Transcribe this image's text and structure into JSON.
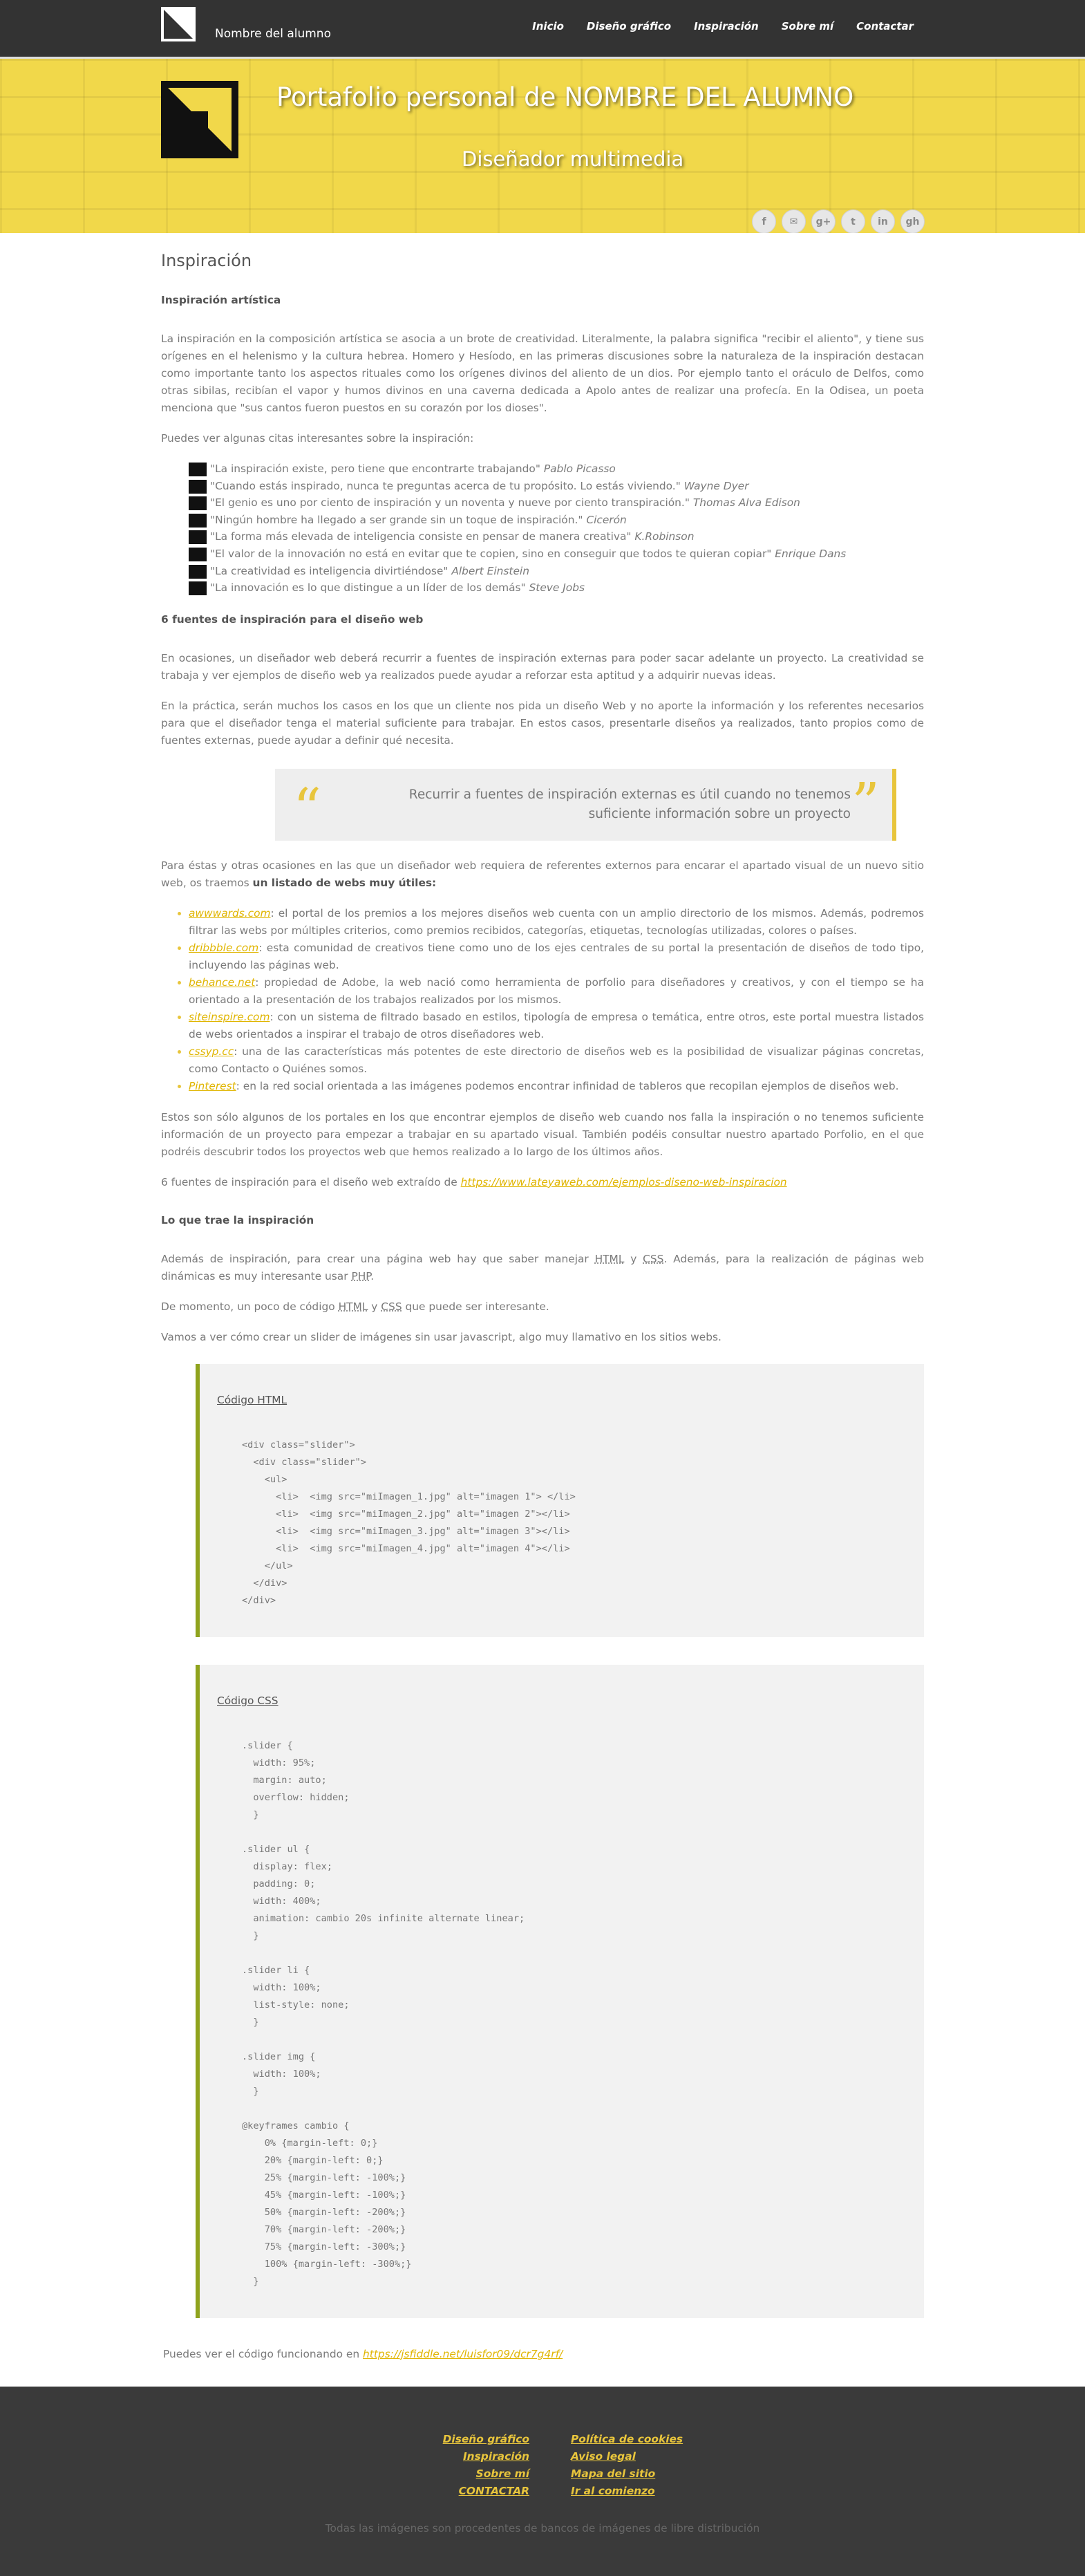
{
  "header": {
    "brand_name": "Nombre del alumno",
    "nav": [
      "Inicio",
      "Diseño gráfico",
      "Inspiración",
      "Sobre mí",
      "Contactar"
    ]
  },
  "hero": {
    "title": "Portafolio personal de NOMBRE DEL ALUMNO",
    "subtitle": "Diseñador multimedia",
    "social_icons": [
      "facebook-icon",
      "email-icon",
      "google-plus-icon",
      "twitter-icon",
      "linkedin-icon",
      "github-icon"
    ],
    "social_glyphs": [
      "f",
      "✉",
      "g+",
      "t",
      "in",
      "gh"
    ]
  },
  "main": {
    "title": "Inspiración",
    "section1_heading": "Inspiración artística",
    "p1": "La inspiración en la composición artística se asocia a un brote de creatividad. Literalmente, la palabra significa \"recibir el aliento\", y tiene sus orígenes en el helenismo y la cultura hebrea. Homero y Hesíodo, en las primeras discusiones sobre la naturaleza de la inspiración destacan como importante tanto los aspectos rituales como los orígenes divinos del aliento de un dios. Por ejemplo tanto el oráculo de Delfos, como otras sibilas, recibían el vapor y humos divinos en una caverna dedicada a Apolo antes de realizar una profecía. En la Odisea, un poeta menciona que \"sus cantos fueron puestos en su corazón por los dioses\".",
    "p2": "Puedes ver algunas citas interesantes sobre la inspiración:",
    "quotes": [
      {
        "text": "\"La inspiración existe, pero tiene que encontrarte trabajando\"",
        "author": "Pablo Picasso"
      },
      {
        "text": "\"Cuando estás inspirado, nunca te preguntas acerca de tu propósito. Lo estás viviendo.\"",
        "author": "Wayne Dyer"
      },
      {
        "text": "\"El genio es uno por ciento de inspiración y un noventa y nueve por ciento transpiración.\"",
        "author": "Thomas Alva Edison"
      },
      {
        "text": "\"Ningún hombre ha llegado a ser grande sin un toque de inspiración.\"",
        "author": "Cicerón"
      },
      {
        "text": "\"La forma más elevada de inteligencia consiste en pensar de manera creativa\"",
        "author": "K.Robinson"
      },
      {
        "text": "\"El valor de la innovación no está en evitar que te copien, sino en conseguir que todos te quieran copiar\"",
        "author": "Enrique Dans"
      },
      {
        "text": "\"La creatividad es inteligencia divirtiéndose\"",
        "author": "Albert Einstein"
      },
      {
        "text": "\"La innovación es lo que distingue a un líder de los demás\"",
        "author": "Steve Jobs"
      }
    ],
    "section2_heading": "6 fuentes de inspiración para el diseño web",
    "p3": "En ocasiones, un diseñador web deberá recurrir a fuentes de inspiración externas para poder sacar adelante un proyecto. La creatividad se trabaja y ver ejemplos de diseño web ya realizados puede ayudar a reforzar esta aptitud y a adquirir nuevas ideas.",
    "p4": "En la práctica, serán muchos los casos en los que un cliente nos pida un diseño Web y no aporte la información y los referentes necesarios para que el diseñador tenga el material suficiente para trabajar. En estos casos, presentarle diseños ya realizados, tanto propios como de fuentes externas, puede ayudar a definir qué necesita.",
    "blockquote": "Recurrir a fuentes de inspiración externas es útil cuando no tenemos suficiente información sobre un proyecto",
    "p5_pre": "Para éstas y otras ocasiones en las que un diseñador web requiera de referentes externos para encarar el apartado visual de un nuevo sitio web, os traemos ",
    "p5_bold": "un listado de webs muy útiles:",
    "links": [
      {
        "name": "awwwards.com",
        "desc": ": el portal de los premios a los mejores diseños web cuenta con un amplio directorio de los mismos. Además, podremos filtrar las webs por múltiples criterios, como premios recibidos, categorías, etiquetas, tecnologías utilizadas, colores o países."
      },
      {
        "name": "dribbble.com",
        "desc": ": esta comunidad de creativos tiene como uno de los ejes centrales de su portal la presentación de diseños de todo tipo, incluyendo las páginas web."
      },
      {
        "name": "behance.net",
        "desc": ": propiedad de Adobe, la web nació como herramienta de porfolio para diseñadores y creativos, y con el tiempo se ha orientado a la presentación de los trabajos realizados por los mismos."
      },
      {
        "name": "siteinspire.com",
        "desc": ": con un sistema de filtrado basado en estilos, tipología de empresa o temática, entre otros, este portal muestra listados de webs orientados a inspirar el trabajo de otros diseñadores web."
      },
      {
        "name": "cssyp.cc",
        "desc": ": una de las características más potentes de este directorio de diseños web es la posibilidad de visualizar páginas concretas, como Contacto o Quiénes somos."
      },
      {
        "name": "Pinterest",
        "desc": ": en la red social orientada a las imágenes podemos encontrar infinidad de tableros que recopilan ejemplos de diseños web."
      }
    ],
    "p6": "Estos son sólo algunos de los portales en los que encontrar ejemplos de diseño web cuando nos falla la inspiración o no tenemos suficiente información de un proyecto para empezar a trabajar en su apartado visual. También podéis consultar nuestro apartado Porfolio, en el que podréis descubrir todos los proyectos web que hemos realizado a lo largo de los últimos años.",
    "p7_pre": "6 fuentes de inspiración para el diseño web extraído de ",
    "p7_link": "https://www.lateyaweb.com/ejemplos-diseno-web-inspiracion",
    "section3_heading": "Lo que trae la inspiración",
    "p8_a": "Además de inspiración, para crear una página web hay que saber manejar ",
    "p8_html": "HTML",
    "p8_b": " y ",
    "p8_css": "CSS",
    "p8_c": ". Además, para la realización de páginas web dinámicas es muy interesante usar ",
    "p8_php": "PHP",
    "p8_d": ".",
    "p9_a": "De momento, un poco de código ",
    "p9_html": "HTML",
    "p9_b": " y ",
    "p9_css": "CSS",
    "p9_c": " que puede ser interesante.",
    "p10": "Vamos a ver cómo crear un slider de imágenes sin usar javascript, algo muy llamativo en los sitios webs.",
    "html_code_title": "Código HTML",
    "html_code": "<div class=\"slider\">\n  <div class=\"slider\">\n    <ul>\n      <li>  <img src=\"miImagen_1.jpg\" alt=\"imagen 1\"> </li>\n      <li>  <img src=\"miImagen_2.jpg\" alt=\"imagen 2\"></li>\n      <li>  <img src=\"miImagen_3.jpg\" alt=\"imagen 3\"></li>\n      <li>  <img src=\"miImagen_4.jpg\" alt=\"imagen 4\"></li>\n    </ul>\n  </div>\n</div>",
    "css_code_title": "Código CSS",
    "css_code": ".slider {\n  width: 95%;\n  margin: auto;\n  overflow: hidden;\n  }\n\n.slider ul {\n  display: flex;\n  padding: 0;\n  width: 400%;\n  animation: cambio 20s infinite alternate linear;\n  }\n\n.slider li {\n  width: 100%;\n  list-style: none;\n  }\n\n.slider img {\n  width: 100%;\n  }\n\n@keyframes cambio {\n    0% {margin-left: 0;}\n    20% {margin-left: 0;}\n    25% {margin-left: -100%;}\n    45% {margin-left: -100%;}\n    50% {margin-left: -200%;}\n    70% {margin-left: -200%;}\n    75% {margin-left: -300%;}\n    100% {margin-left: -300%;}\n  }",
    "p11_pre": "Puedes ver el código funcionando en ",
    "p11_link": "https://jsfiddle.net/luisfor09/dcr7g4rf/"
  },
  "footer": {
    "left_links": [
      "Diseño gráfico",
      "Inspiración",
      "Sobre mí",
      "CONTACTAR"
    ],
    "right_links": [
      "Política de cookies",
      "Aviso legal",
      "Mapa del sitio",
      "Ir al comienzo"
    ],
    "note": "Todas las imágenes son procedentes de bancos de imágenes de libre distribución"
  },
  "colors": {
    "accent": "#e8c53c",
    "header_bg": "#333333",
    "footer_bg": "#3a3a3a",
    "code_border": "#8fa31d"
  }
}
